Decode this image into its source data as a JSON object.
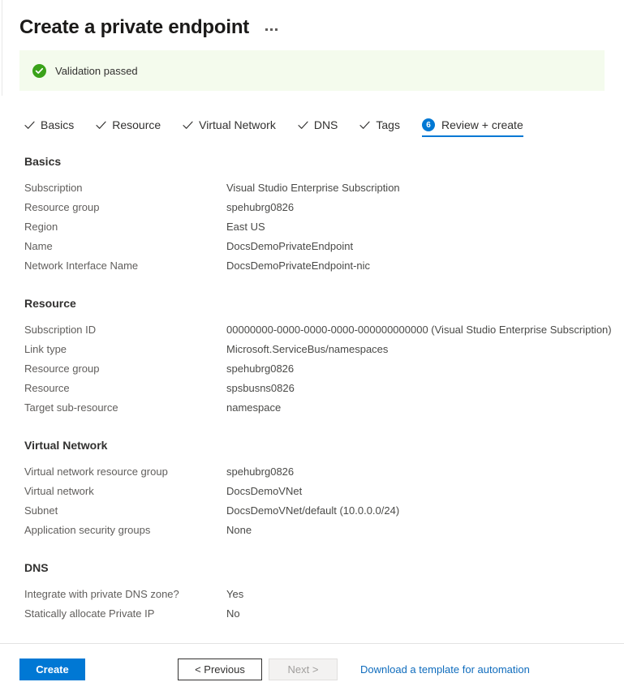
{
  "header": {
    "title": "Create a private endpoint",
    "more_menu": "…"
  },
  "validation": {
    "icon": "check-circle-icon",
    "message": "Validation passed",
    "background_color": "#f4fbed",
    "icon_color": "#3aa21a"
  },
  "tabs": [
    {
      "label": "Basics",
      "state": "completed",
      "marker": "✓"
    },
    {
      "label": "Resource",
      "state": "completed",
      "marker": "✓"
    },
    {
      "label": "Virtual Network",
      "state": "completed",
      "marker": "✓"
    },
    {
      "label": "DNS",
      "state": "completed",
      "marker": "✓"
    },
    {
      "label": "Tags",
      "state": "completed",
      "marker": "✓"
    },
    {
      "label": "Review + create",
      "state": "active",
      "marker": "6"
    }
  ],
  "sections": [
    {
      "title": "Basics",
      "rows": [
        {
          "label": "Subscription",
          "value": "Visual Studio Enterprise Subscription"
        },
        {
          "label": "Resource group",
          "value": "spehubrg0826"
        },
        {
          "label": "Region",
          "value": "East US"
        },
        {
          "label": "Name",
          "value": "DocsDemoPrivateEndpoint"
        },
        {
          "label": "Network Interface Name",
          "value": "DocsDemoPrivateEndpoint-nic"
        }
      ]
    },
    {
      "title": "Resource",
      "rows": [
        {
          "label": "Subscription ID",
          "value": "00000000-0000-0000-0000-000000000000 (Visual Studio Enterprise Subscription)"
        },
        {
          "label": "Link type",
          "value": "Microsoft.ServiceBus/namespaces"
        },
        {
          "label": "Resource group",
          "value": "spehubrg0826"
        },
        {
          "label": "Resource",
          "value": "spsbusns0826"
        },
        {
          "label": "Target sub-resource",
          "value": "namespace"
        }
      ]
    },
    {
      "title": "Virtual Network",
      "rows": [
        {
          "label": "Virtual network resource group",
          "value": "spehubrg0826"
        },
        {
          "label": "Virtual network",
          "value": "DocsDemoVNet"
        },
        {
          "label": "Subnet",
          "value": "DocsDemoVNet/default (10.0.0.0/24)"
        },
        {
          "label": "Application security groups",
          "value": "None"
        }
      ]
    },
    {
      "title": "DNS",
      "rows": [
        {
          "label": "Integrate with private DNS zone?",
          "value": "Yes"
        },
        {
          "label": "Statically allocate Private IP",
          "value": "No"
        }
      ]
    }
  ],
  "footer": {
    "create_label": "Create",
    "previous_label": "< Previous",
    "next_label": "Next >",
    "next_disabled": true,
    "download_link_label": "Download a template for automation",
    "accent_color": "#0078d4",
    "link_color": "#0f6cbd"
  }
}
